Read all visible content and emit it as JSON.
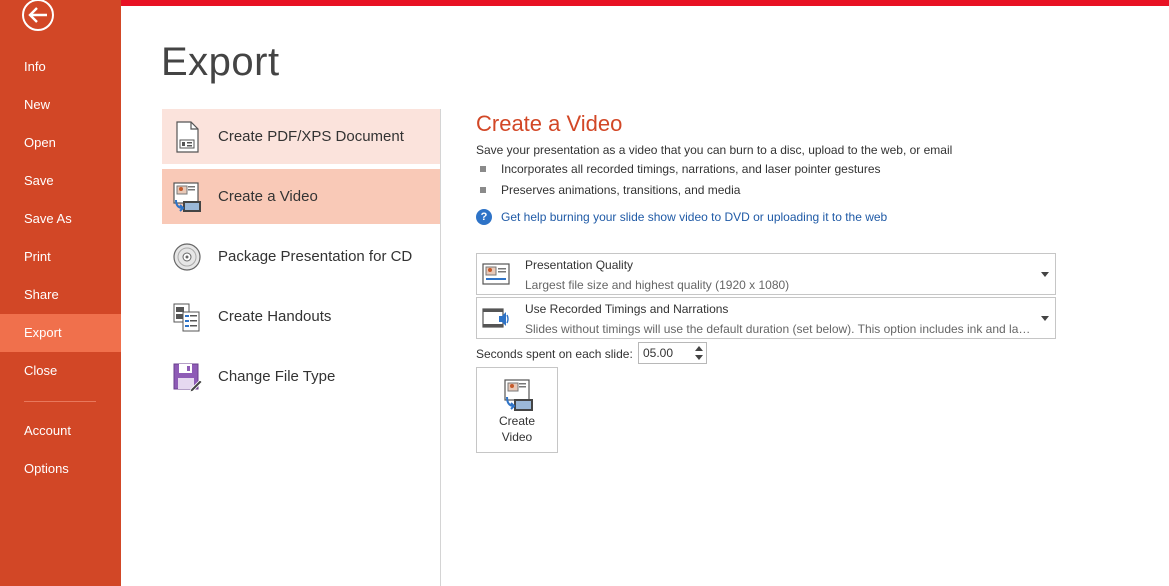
{
  "sidebar": {
    "items": [
      {
        "label": "Info"
      },
      {
        "label": "New"
      },
      {
        "label": "Open"
      },
      {
        "label": "Save"
      },
      {
        "label": "Save As"
      },
      {
        "label": "Print"
      },
      {
        "label": "Share"
      },
      {
        "label": "Export"
      },
      {
        "label": "Close"
      },
      {
        "label": "Account"
      },
      {
        "label": "Options"
      }
    ],
    "active": "Export"
  },
  "main": {
    "title": "Export",
    "options": [
      {
        "label": "Create PDF/XPS Document",
        "icon": "pdf-document-icon"
      },
      {
        "label": "Create a Video",
        "icon": "video-icon"
      },
      {
        "label": "Package Presentation for CD",
        "icon": "cd-icon"
      },
      {
        "label": "Create Handouts",
        "icon": "handouts-icon"
      },
      {
        "label": "Change File Type",
        "icon": "save-file-type-icon"
      }
    ]
  },
  "panel": {
    "title": "Create a Video",
    "description": "Save your presentation as a video that you can burn to a disc, upload to the web, or email",
    "bullets": [
      "Incorporates all recorded timings, narrations, and laser pointer gestures",
      "Preserves animations, transitions, and media"
    ],
    "help_link": "Get help burning your slide show video to DVD or uploading it to the web",
    "quality": {
      "title": "Presentation Quality",
      "subtitle": "Largest file size and highest quality (1920 x 1080)"
    },
    "timings": {
      "title": "Use Recorded Timings and Narrations",
      "subtitle": "Slides without timings will use the default duration (set below). This option includes ink and laser pointer gestures."
    },
    "seconds_label": "Seconds spent on each slide:",
    "seconds_value": "05.00",
    "create_button": {
      "line1": "Create",
      "line2": "Video"
    }
  },
  "colors": {
    "sidebar": "#d24726",
    "sidebar_active": "#f0704c",
    "accent": "#d24726",
    "link": "#1f5aa6",
    "topbar": "#e81123"
  }
}
